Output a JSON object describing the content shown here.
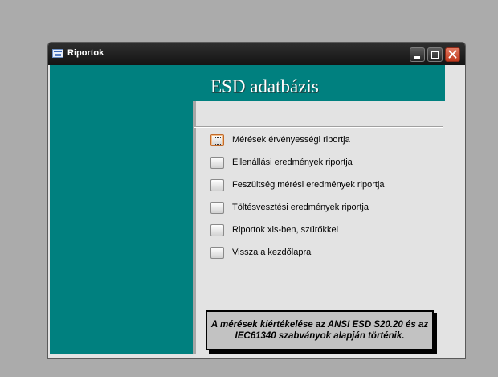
{
  "window": {
    "title": "Riportok",
    "icon": "form-icon",
    "controls": [
      "minimize-icon",
      "maximize-icon",
      "close-icon"
    ],
    "accent_color": "#00807f"
  },
  "header": {
    "title": "ESD adatbázis"
  },
  "menu": {
    "items": [
      {
        "label": "Mérések érvényességi riportja",
        "selected": true
      },
      {
        "label": "Ellenállási eredmények riportja",
        "selected": false
      },
      {
        "label": "Feszültség mérési eredmények riportja",
        "selected": false
      },
      {
        "label": "Töltésvesztési eredmények riportja",
        "selected": false
      },
      {
        "label": "Riportok xls-ben, szűrőkkel",
        "selected": false
      },
      {
        "label": "Vissza a kezdőlapra",
        "selected": false
      }
    ]
  },
  "note": {
    "text": "A mérések kiértékelése az ANSI ESD S20.20 és az IEC61340 szabványok alapján történik."
  }
}
